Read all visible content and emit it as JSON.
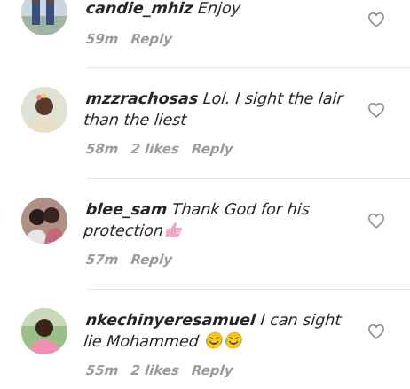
{
  "comments": [
    {
      "username": "candie_mhiz",
      "text": " Enjoy",
      "time": "59m",
      "likes": "",
      "reply_label": "Reply",
      "emoji": []
    },
    {
      "username": "mzzrachosas",
      "text": " Lol. I sight the lair than the liest",
      "time": "58m",
      "likes": "2 likes",
      "reply_label": "Reply",
      "emoji": []
    },
    {
      "username": "blee_sam",
      "text": " Thank God for his protection",
      "time": "57m",
      "likes": "",
      "reply_label": "Reply",
      "emoji": [
        "thumbs-up-emoji"
      ]
    },
    {
      "username": "nkechinyeresamuel",
      "text": " I can sight lie Mohammed",
      "time": "55m",
      "likes": "2 likes",
      "reply_label": "Reply",
      "emoji": [
        "laughing-emoji",
        "laughing-emoji"
      ]
    }
  ],
  "colors": {
    "text": "#262626",
    "meta": "#9a9a9a",
    "divider": "#e4e4e4",
    "heart": "#8e8e8e",
    "emoji_yellow": "#f5c518",
    "thumbs_pink": "#f2a2c7"
  },
  "icons": {
    "like": "heart-outline-icon"
  }
}
